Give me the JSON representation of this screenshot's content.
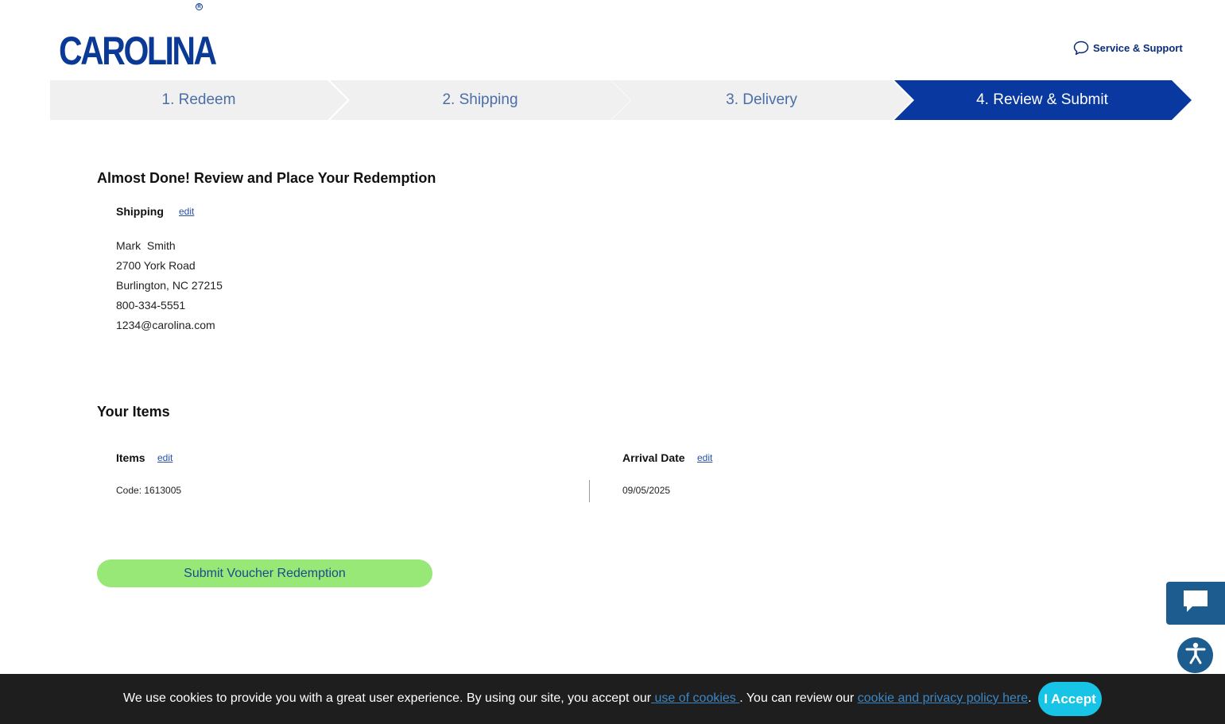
{
  "header": {
    "logo_text": "CAROLINA",
    "support_label": "Service & Support"
  },
  "steps": [
    {
      "label": "1. Redeem",
      "active": false
    },
    {
      "label": "2. Shipping",
      "active": false
    },
    {
      "label": "3. Delivery",
      "active": false
    },
    {
      "label": "4. Review & Submit",
      "active": true
    }
  ],
  "colors": {
    "brand_blue": "#0a3a96",
    "step_inactive": "#f0f0f0",
    "step_active": "#0838a0",
    "submit_green": "#98e878",
    "accept_cyan": "#17c4e6"
  },
  "review": {
    "heading": "Almost Done! Review and Place Your Redemption",
    "shipping_label": "Shipping",
    "edit_label": "edit",
    "address_lines": [
      "Mark  Smith",
      "2700 York Road",
      "Burlington, NC 27215",
      "800-334-5551",
      "1234@carolina.com"
    ]
  },
  "items": {
    "heading": "Your Items",
    "items_label": "Items",
    "items_edit": "edit",
    "code": "Code: 1613005",
    "arrival_label": "Arrival Date",
    "arrival_edit": "edit",
    "arrival_date": "09/05/2025"
  },
  "submit_label": "Submit Voucher Redemption",
  "cookie": {
    "text_before": "We use cookies to provide you with a great user experience. By using our site, you accept our",
    "link1": " use of cookies ",
    "text_middle": ". You can review our ",
    "link2": "cookie and privacy policy here",
    "text_after": ".",
    "accept_label": "I Accept"
  },
  "icons": {
    "support": "speech-bubble-icon",
    "chat": "chat-icon",
    "accessibility": "accessibility-icon"
  }
}
